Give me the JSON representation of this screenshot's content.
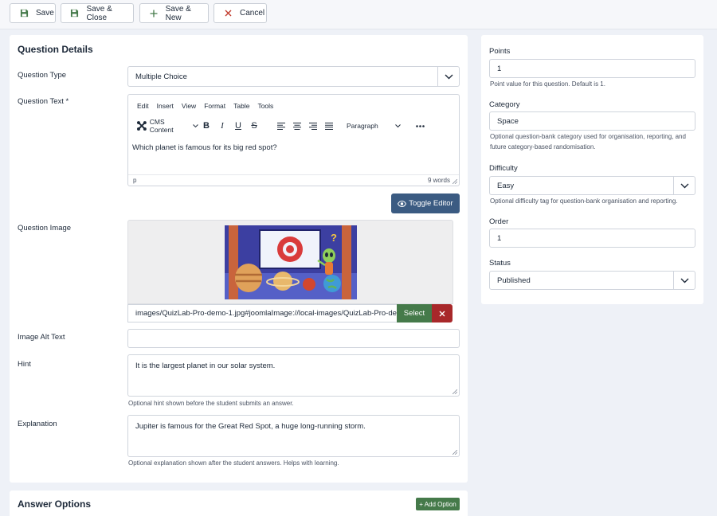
{
  "toolbar": {
    "save": "Save",
    "save_close": "Save & Close",
    "save_new": "Save & New",
    "cancel": "Cancel"
  },
  "details": {
    "title": "Question Details",
    "type_label": "Question Type",
    "type_value": "Multiple Choice",
    "text_label": "Question Text *",
    "editor": {
      "menu": [
        "Edit",
        "Insert",
        "View",
        "Format",
        "Table",
        "Tools"
      ],
      "cms_content": "CMS Content",
      "block_format": "Paragraph",
      "content": "Which planet is famous for its big red spot?",
      "path": "p",
      "word_count": "9 words"
    },
    "toggle_editor": "Toggle Editor",
    "image_label": "Question Image",
    "image_path": "images/QuizLab-Pro-demo-1.jpg#joomlaImage://local-images/QuizLab-Pro-demo-1.jpg",
    "select": "Select",
    "alt_label": "Image Alt Text",
    "alt_value": "",
    "hint_label": "Hint",
    "hint_value": "It is the largest planet in our solar system.",
    "hint_help": "Optional hint shown before the student submits an answer.",
    "explanation_label": "Explanation",
    "explanation_value": "Jupiter is famous for the Great Red Spot, a huge long-running storm.",
    "explanation_help": "Optional explanation shown after the student answers. Helps with learning."
  },
  "sidebar": {
    "points_label": "Points",
    "points_value": "1",
    "points_help": "Point value for this question. Default is 1.",
    "category_label": "Category",
    "category_value": "Space",
    "category_help": "Optional question-bank category used for organisation, reporting, and future category-based randomisation.",
    "difficulty_label": "Difficulty",
    "difficulty_value": "Easy",
    "difficulty_help": "Optional difficulty tag for question-bank organisation and reporting.",
    "order_label": "Order",
    "order_value": "1",
    "status_label": "Status",
    "status_value": "Published"
  },
  "answers": {
    "title": "Answer Options",
    "add_option": "+ Add Option"
  },
  "colors": {
    "save_green": "#457a4a",
    "cancel_red": "#c0392b",
    "toggle_blue": "#3b5b82",
    "clear_red": "#a8282a"
  }
}
